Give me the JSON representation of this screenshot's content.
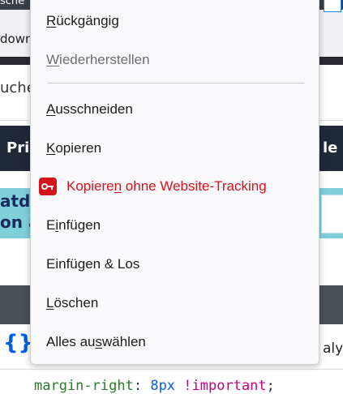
{
  "background": {
    "top_fragment": "sche",
    "row2_fragment": "down",
    "search_fragment": "uche",
    "nav_left_fragment": "Pri",
    "nav_right_fragment": "le",
    "banner_fragment_1": "atde",
    "banner_fragment_2": "on a",
    "devtools_icon": "{}",
    "right_fragment": "aly",
    "code_line": {
      "property": "margin-right",
      "colon": ":",
      "value": "8px",
      "important": "!important",
      "semicolon": ";"
    }
  },
  "context_menu": {
    "items": [
      {
        "label": "Rückgängig",
        "underline_index": 0,
        "state": "enabled"
      },
      {
        "label": "Wiederherstellen",
        "underline_index": 0,
        "state": "disabled"
      },
      {
        "label": "Ausschneiden",
        "underline_index": 0,
        "state": "enabled"
      },
      {
        "label": "Kopieren",
        "underline_index": 0,
        "state": "enabled"
      },
      {
        "label": "Kopieren ohne Website-Tracking",
        "underline_index": 7,
        "state": "highlight",
        "icon": "key-icon"
      },
      {
        "label": "Einfügen",
        "underline_index": 1,
        "state": "enabled"
      },
      {
        "label": "Einfügen & Los",
        "underline_index": -1,
        "state": "enabled"
      },
      {
        "label": "Löschen",
        "underline_index": 0,
        "state": "enabled"
      },
      {
        "label": "Alles auswählen",
        "underline_index": 8,
        "state": "enabled"
      }
    ]
  },
  "colors": {
    "highlight_red": "#d4141c",
    "nav_dark": "#1f2937",
    "banner_teal": "#7fcfd8",
    "devtools_gray": "#4b5057"
  }
}
